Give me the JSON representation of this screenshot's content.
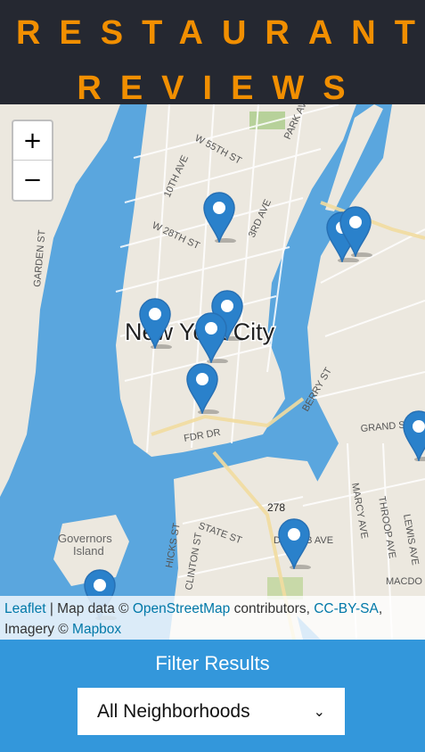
{
  "header": {
    "title_line1": "RESTAURANT",
    "title_line2": "REVIEWS"
  },
  "map": {
    "zoom_in_label": "+",
    "zoom_out_label": "−",
    "labels": {
      "city": "New York City",
      "governors_island_1": "Governors",
      "governors_island_2": "Island",
      "streets": [
        "W 55TH ST",
        "10TH AVE",
        "W 28TH ST",
        "3RD AVE",
        "PARK AVE",
        "GARDEN ST",
        "BERRY ST",
        "GRAND ST",
        "FDR DR",
        "HICKS ST",
        "CLINTON ST",
        "STATE ST",
        "DEKALB AVE",
        "MARCY AVE",
        "THROOP AVE",
        "LEWIS AVE",
        "MACDO",
        "278"
      ]
    },
    "marker_count": 10
  },
  "attribution": {
    "leaflet": "Leaflet",
    "sep": " | Map data © ",
    "osm": "OpenStreetMap",
    "contributors": " contributors, ",
    "license": "CC-BY-SA",
    "comma": ",",
    "imagery": "Imagery © ",
    "mapbox": "Mapbox"
  },
  "filter": {
    "heading": "Filter Results",
    "neighborhood_selected": "All Neighborhoods"
  },
  "colors": {
    "header_bg": "#252831",
    "title": "#f18f01",
    "filter_bg": "#3397db",
    "marker": "#2a81cb",
    "water": "#4f9fdc"
  }
}
